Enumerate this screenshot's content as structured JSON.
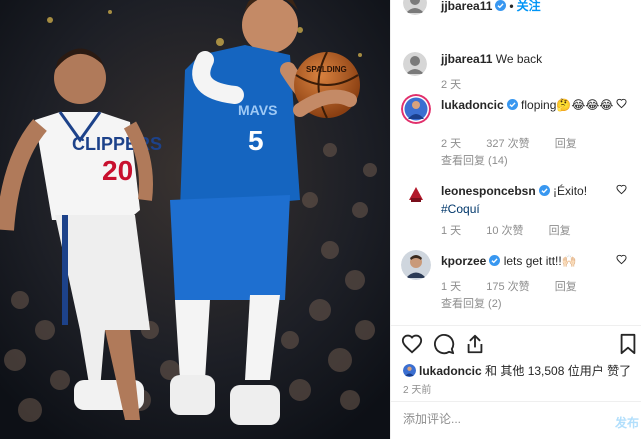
{
  "post_image": {
    "description_icon": "basketball-game-photo",
    "left_jersey": {
      "team": "CLIPPERS",
      "number": "20"
    },
    "right_jersey": {
      "team": "MAVS",
      "number": "5"
    },
    "ball_brand": "SPALDING"
  },
  "header": {
    "username": "jjbarea11",
    "separator": "•",
    "follow_label": "关注"
  },
  "caption": {
    "username": "jjbarea11",
    "text": "We back",
    "time": "2 天"
  },
  "comments": [
    {
      "username": "lukadoncic",
      "verified": true,
      "text": "floping🤔😂😂😂",
      "time": "2 天",
      "likes": "327 次赞",
      "reply": "回复",
      "view_replies": "查看回复 (14)"
    },
    {
      "username": "leonesponcebsn",
      "verified": true,
      "text": "¡Éxito!",
      "hashtag": "#Coquí",
      "time": "1 天",
      "likes": "10 次赞",
      "reply": "回复",
      "view_replies": ""
    },
    {
      "username": "kporzee",
      "verified": true,
      "text": "lets get itt!!🙌🏻",
      "time": "1 天",
      "likes": "175 次赞",
      "reply": "回复",
      "view_replies": "查看回复 (2)"
    }
  ],
  "likes_summary": {
    "user": "lukadoncic",
    "rest": "和 其他 13,508 位用户 赞了"
  },
  "posted_ago": "2 天前",
  "add_comment": {
    "placeholder": "添加评论...",
    "post_label": "发布"
  },
  "icons": [
    "heart-icon",
    "comment-icon",
    "share-icon",
    "bookmark-icon",
    "verified-badge-icon"
  ],
  "colors": {
    "accent": "#0095f6",
    "verified": "#3897f0",
    "mavs_blue": "#1565c0",
    "clippers_red": "#c8102e",
    "muted": "#8e8e8e"
  }
}
